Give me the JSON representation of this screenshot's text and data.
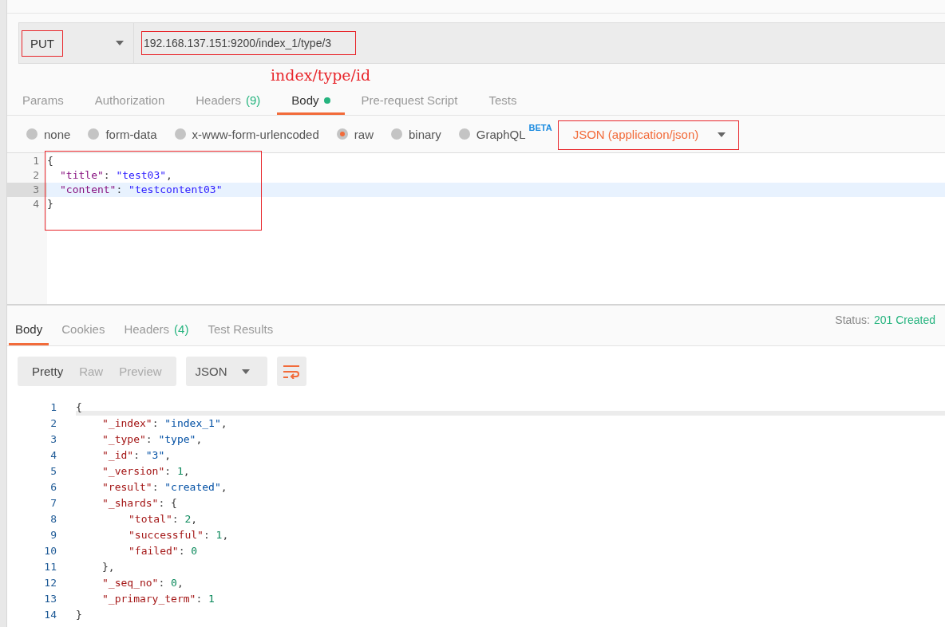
{
  "request": {
    "method": "PUT",
    "method_highlighted": true,
    "url": "192.168.137.151:9200/index_1/type/3",
    "url_highlighted": true
  },
  "annotation": "index/type/id",
  "request_tabs": [
    {
      "label": "Params",
      "selected": false
    },
    {
      "label": "Authorization",
      "selected": false
    },
    {
      "label": "Headers",
      "count": "(9)",
      "selected": false
    },
    {
      "label": "Body",
      "selected": true,
      "dot": true
    },
    {
      "label": "Pre-request Script",
      "selected": false
    },
    {
      "label": "Tests",
      "selected": false
    }
  ],
  "body_types": [
    {
      "label": "none",
      "selected": false
    },
    {
      "label": "form-data",
      "selected": false
    },
    {
      "label": "x-www-form-urlencoded",
      "selected": false
    },
    {
      "label": "raw",
      "selected": true
    },
    {
      "label": "binary",
      "selected": false
    },
    {
      "label": "GraphQL",
      "badge": "BETA",
      "selected": false
    }
  ],
  "content_type": {
    "label": "JSON (application/json)",
    "highlighted": true
  },
  "editor": {
    "highlighted": true,
    "lines": [
      {
        "number": "1",
        "active": false,
        "tokens": [
          {
            "kind": "punct",
            "text": "{"
          }
        ],
        "children": [
          {
            "number": "2",
            "active": false,
            "tokens": [
              {
                "kind": "key",
                "text": "\"title\""
              },
              {
                "kind": "punct",
                "text": ": "
              },
              {
                "kind": "string",
                "text": "\"test03\""
              },
              {
                "kind": "punct",
                "text": ","
              }
            ]
          },
          {
            "number": "3",
            "active": true,
            "tokens": [
              {
                "kind": "key",
                "text": "\"content\""
              },
              {
                "kind": "punct",
                "text": ": "
              },
              {
                "kind": "string",
                "text": "\"testcontent03\""
              }
            ]
          }
        ]
      },
      {
        "number": "4",
        "active": false,
        "tokens": [
          {
            "kind": "punct",
            "text": "}"
          }
        ]
      }
    ]
  },
  "response_tabs": [
    {
      "label": "Body",
      "selected": true
    },
    {
      "label": "Cookies",
      "selected": false
    },
    {
      "label": "Headers",
      "count": "(4)",
      "selected": false
    },
    {
      "label": "Test Results",
      "selected": false
    }
  ],
  "status": {
    "label": "Status:",
    "value": "201 Created"
  },
  "view_modes": [
    {
      "label": "Pretty",
      "selected": true
    },
    {
      "label": "Raw",
      "selected": false
    },
    {
      "label": "Preview",
      "selected": false
    }
  ],
  "format": "JSON",
  "response_lines": [
    {
      "number": "1",
      "tokens": [
        {
          "kind": "punct",
          "text": "{"
        }
      ],
      "children": [
        {
          "number": "2",
          "tokens": [
            {
              "kind": "key",
              "text": "\"_index\""
            },
            {
              "kind": "punct",
              "text": ": "
            },
            {
              "kind": "string",
              "text": "\"index_1\""
            },
            {
              "kind": "punct",
              "text": ","
            }
          ]
        },
        {
          "number": "3",
          "tokens": [
            {
              "kind": "key",
              "text": "\"_type\""
            },
            {
              "kind": "punct",
              "text": ": "
            },
            {
              "kind": "string",
              "text": "\"type\""
            },
            {
              "kind": "punct",
              "text": ","
            }
          ]
        },
        {
          "number": "4",
          "tokens": [
            {
              "kind": "key",
              "text": "\"_id\""
            },
            {
              "kind": "punct",
              "text": ": "
            },
            {
              "kind": "string",
              "text": "\"3\""
            },
            {
              "kind": "punct",
              "text": ","
            }
          ]
        },
        {
          "number": "5",
          "tokens": [
            {
              "kind": "key",
              "text": "\"_version\""
            },
            {
              "kind": "punct",
              "text": ": "
            },
            {
              "kind": "number",
              "text": "1"
            },
            {
              "kind": "punct",
              "text": ","
            }
          ]
        },
        {
          "number": "6",
          "tokens": [
            {
              "kind": "key",
              "text": "\"result\""
            },
            {
              "kind": "punct",
              "text": ": "
            },
            {
              "kind": "string",
              "text": "\"created\""
            },
            {
              "kind": "punct",
              "text": ","
            }
          ]
        },
        {
          "number": "7",
          "tokens": [
            {
              "kind": "key",
              "text": "\"_shards\""
            },
            {
              "kind": "punct",
              "text": ": {"
            }
          ],
          "children": [
            {
              "number": "8",
              "tokens": [
                {
                  "kind": "key",
                  "text": "\"total\""
                },
                {
                  "kind": "punct",
                  "text": ": "
                },
                {
                  "kind": "number",
                  "text": "2"
                },
                {
                  "kind": "punct",
                  "text": ","
                }
              ]
            },
            {
              "number": "9",
              "tokens": [
                {
                  "kind": "key",
                  "text": "\"successful\""
                },
                {
                  "kind": "punct",
                  "text": ": "
                },
                {
                  "kind": "number",
                  "text": "1"
                },
                {
                  "kind": "punct",
                  "text": ","
                }
              ]
            },
            {
              "number": "10",
              "tokens": [
                {
                  "kind": "key",
                  "text": "\"failed\""
                },
                {
                  "kind": "punct",
                  "text": ": "
                },
                {
                  "kind": "number",
                  "text": "0"
                }
              ]
            }
          ]
        },
        {
          "number": "11",
          "tokens": [
            {
              "kind": "punct",
              "text": "},"
            }
          ]
        },
        {
          "number": "12",
          "tokens": [
            {
              "kind": "key",
              "text": "\"_seq_no\""
            },
            {
              "kind": "punct",
              "text": ": "
            },
            {
              "kind": "number",
              "text": "0"
            },
            {
              "kind": "punct",
              "text": ","
            }
          ]
        },
        {
          "number": "13",
          "tokens": [
            {
              "kind": "key",
              "text": "\"_primary_term\""
            },
            {
              "kind": "punct",
              "text": ": "
            },
            {
              "kind": "number",
              "text": "1"
            }
          ]
        }
      ]
    },
    {
      "number": "14",
      "tokens": [
        {
          "kind": "punct",
          "text": "}"
        }
      ]
    }
  ]
}
